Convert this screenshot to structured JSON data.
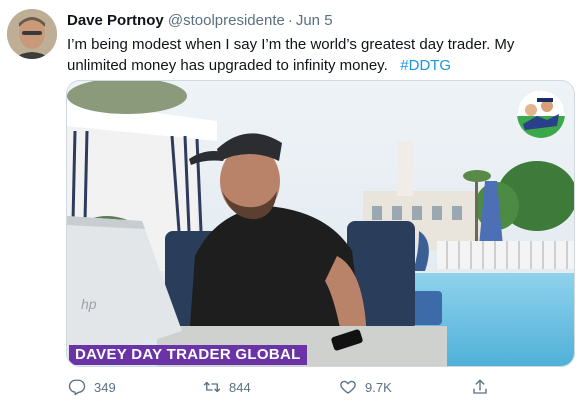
{
  "author": {
    "name": "Dave Portnoy",
    "handle": "@stoolpresidente",
    "date": "Jun 5"
  },
  "tweet": {
    "text": "I’m being modest when I say I’m the world’s greatest day trader.  My unlimited money has upgraded to infinity money.",
    "hashtag": "#DDTG"
  },
  "media": {
    "caption": "DAVEY DAY TRADER GLOBAL",
    "caption_color": "#6a34a6"
  },
  "actions": {
    "reply_count": "349",
    "retweet_count": "844",
    "like_count": "9.7K"
  },
  "colors": {
    "link": "#1b95e0",
    "muted": "#5b7083"
  },
  "icons": [
    "reply-icon",
    "retweet-icon",
    "like-icon",
    "share-icon"
  ]
}
